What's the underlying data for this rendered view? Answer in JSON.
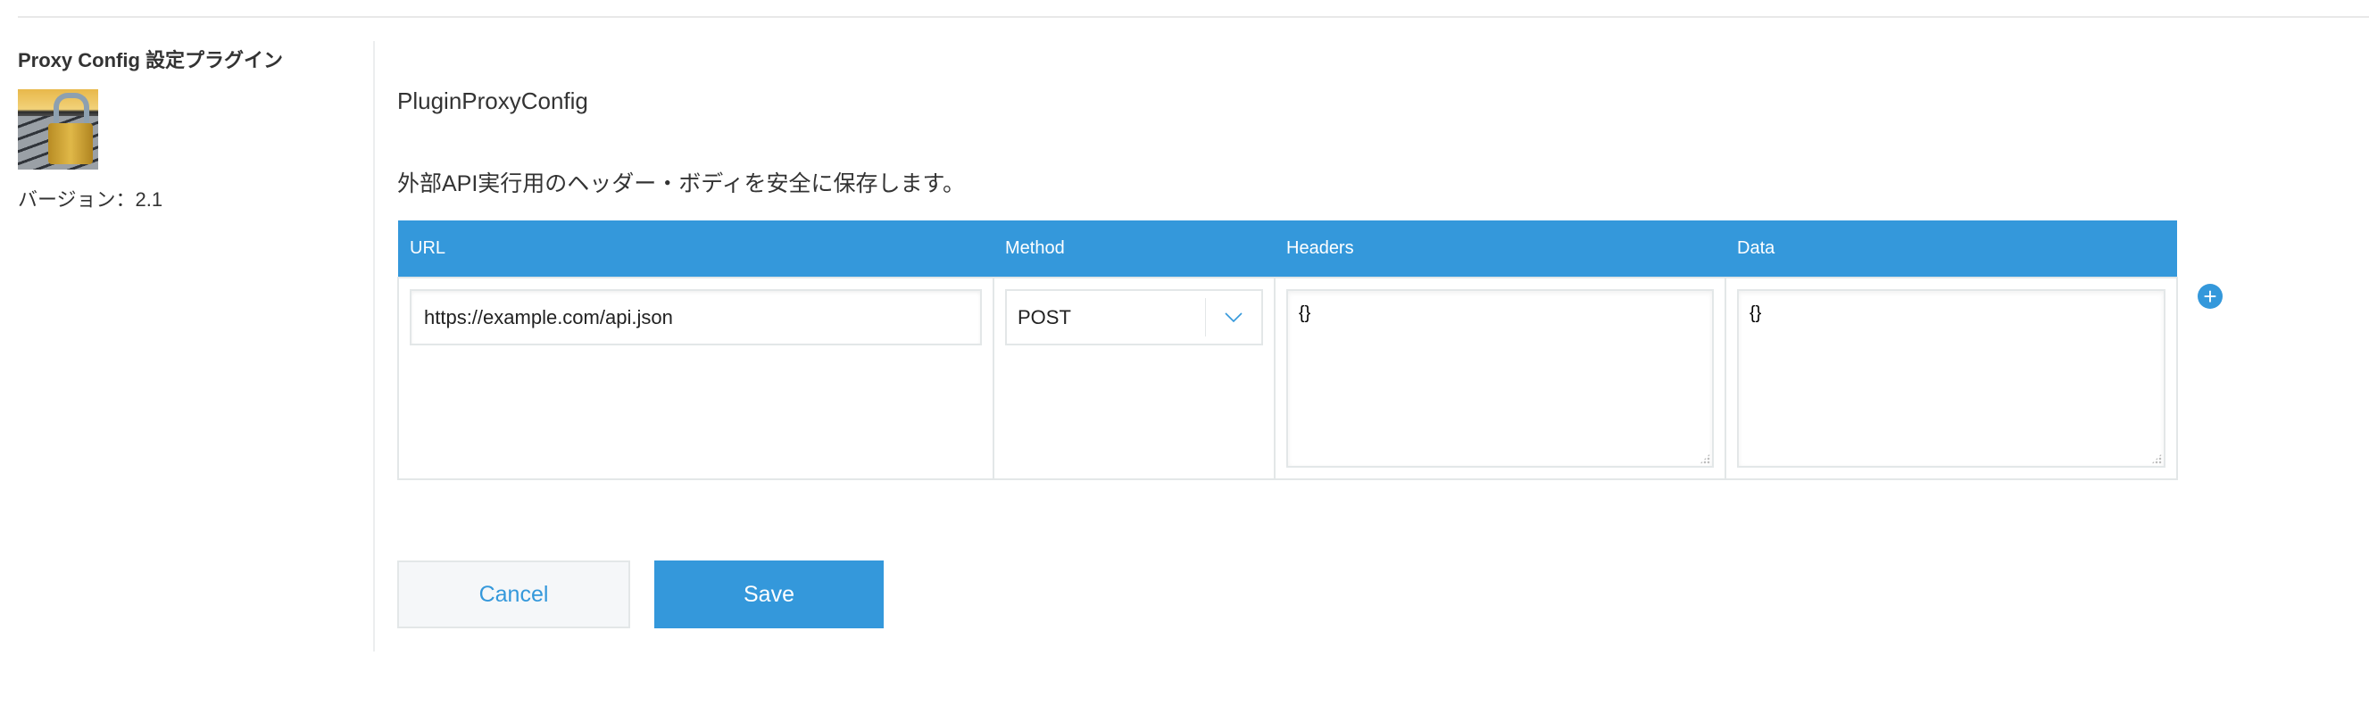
{
  "plugin": {
    "title": "Proxy Config 設定プラグイン",
    "icon": "padlock-keyboard-icon",
    "version_label": "バージョン：2.1"
  },
  "main": {
    "name": "PluginProxyConfig",
    "description": "外部API実行用のヘッダー・ボディを安全に保存します。"
  },
  "table": {
    "headers": [
      "URL",
      "Method",
      "Headers",
      "Data"
    ],
    "rows": [
      {
        "url": "https://example.com/api.json",
        "method": "POST",
        "headers": "{}",
        "data": "{}"
      }
    ]
  },
  "buttons": {
    "add": "+",
    "cancel": "Cancel",
    "save": "Save"
  },
  "colors": {
    "accent": "#3498db",
    "border": "#e3e7e8",
    "cancel_bg": "#f5f7f9"
  }
}
